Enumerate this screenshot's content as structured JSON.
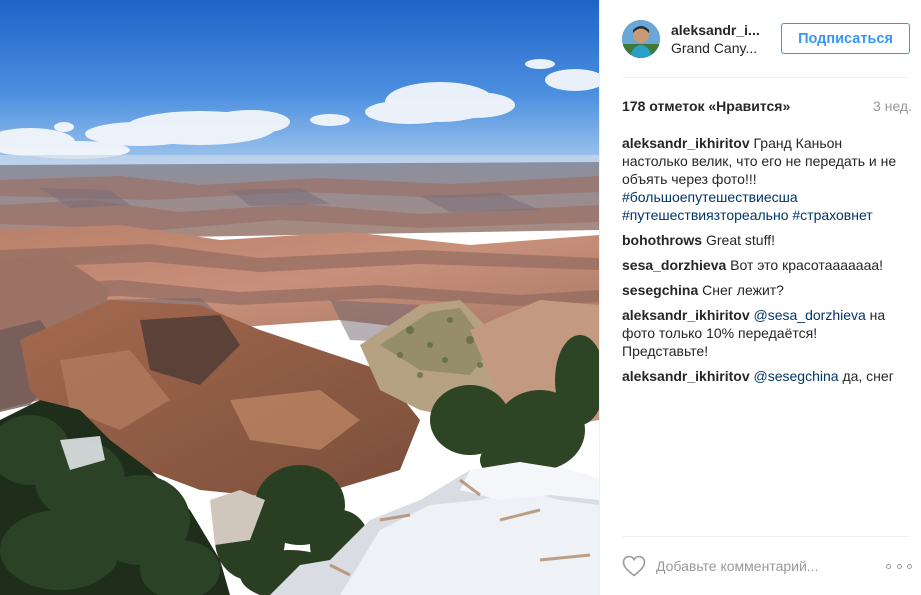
{
  "header": {
    "username": "aleksandr_i...",
    "location": "Grand Cany...",
    "follow_label": "Подписаться"
  },
  "stats": {
    "likes": "178 отметок «Нравится»",
    "time": "3 нед."
  },
  "caption": {
    "user": "aleksandr_ikhiritov",
    "text": " Гранд Каньон настолько велик, что его не передать и не объять через фото!!! ",
    "tags": [
      "#большоепутешествиесша",
      "#путешествиязтореально",
      "#страховнет"
    ]
  },
  "comments": [
    {
      "user": "bohothrows",
      "mention": "",
      "text": " Great stuff!"
    },
    {
      "user": "sesa_dorzhieva",
      "mention": "",
      "text": " Вот это красотааааааа!"
    },
    {
      "user": "sesegchina",
      "mention": "",
      "text": " Снег лежит?"
    },
    {
      "user": "aleksandr_ikhiritov",
      "mention": "@sesa_dorzhieva",
      "text": " на фото только 10% передаётся! Представьте!"
    },
    {
      "user": "aleksandr_ikhiritov",
      "mention": "@sesegchina",
      "text": " да, снег"
    }
  ],
  "footer": {
    "comment_placeholder": "Добавьте комментарий...",
    "like_icon": "heart-outline-icon",
    "more_icon": "more-options-icon"
  },
  "colors": {
    "accent": "#3897f0",
    "text": "#262626",
    "muted": "#999999",
    "link": "#003569",
    "divider": "#efefef"
  }
}
